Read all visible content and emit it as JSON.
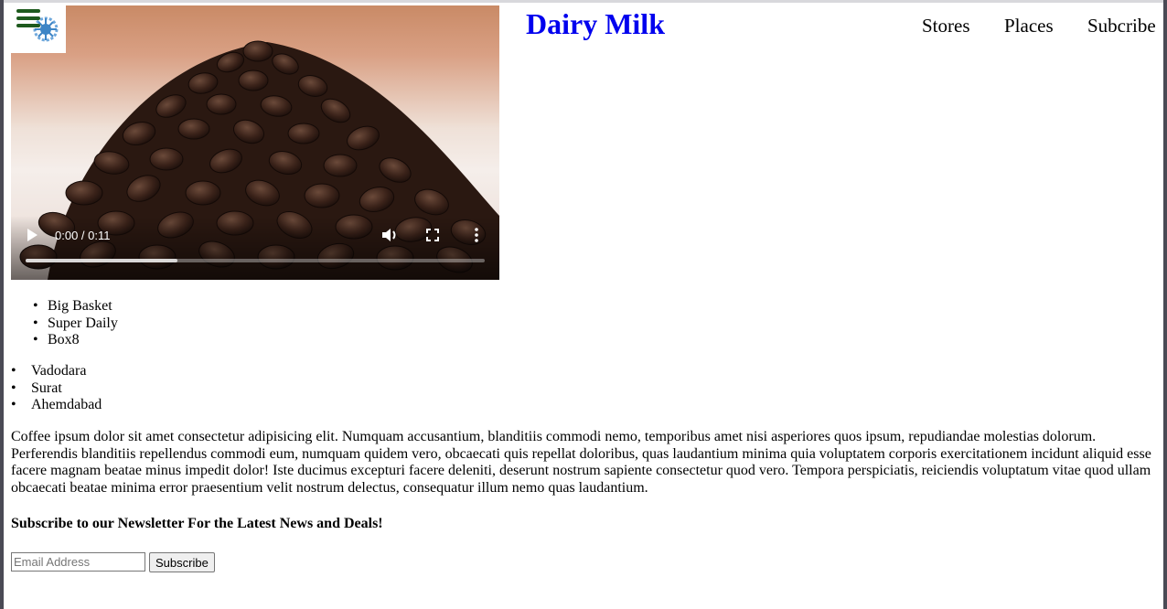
{
  "header": {
    "brand": "Dairy Milk",
    "nav": [
      "Stores",
      "Places",
      "Subcribe"
    ]
  },
  "video": {
    "time": "0:00 / 0:11",
    "progress": 0.33
  },
  "stores": [
    "Big Basket",
    "Super Daily",
    "Box8"
  ],
  "places": [
    "Vadodara",
    "Surat",
    "Ahemdabad"
  ],
  "paragraph": "Coffee ipsum dolor sit amet consectetur adipisicing elit. Numquam accusantium, blanditiis commodi nemo, temporibus amet nisi asperiores quos ipsum, repudiandae molestias dolorum. Perferendis blanditiis repellendus commodi eum, numquam quidem vero, obcaecati quis repellat doloribus, quas laudantium minima quia voluptatem corporis exercitationem incidunt aliquid esse facere magnam beatae minus impedit dolor! Iste ducimus excepturi facere deleniti, deserunt nostrum sapiente consectetur quod vero. Tempora perspiciatis, reiciendis voluptatum vitae quod ullam obcaecati beatae minima error praesentium velit nostrum delectus, consequatur illum nemo quas laudantium.",
  "newsletter": {
    "heading": "Subscribe to our Newsletter For the Latest News and Deals!",
    "email_placeholder": "Email Address",
    "email_value": "",
    "button_label": "Subscribe"
  },
  "colors": {
    "brand": "#0000ee",
    "hamburger": "#1e5a1e"
  },
  "icons": [
    "menu-icon",
    "logo-gear-icon",
    "play-icon",
    "volume-icon",
    "fullscreen-icon",
    "more-options-icon"
  ]
}
